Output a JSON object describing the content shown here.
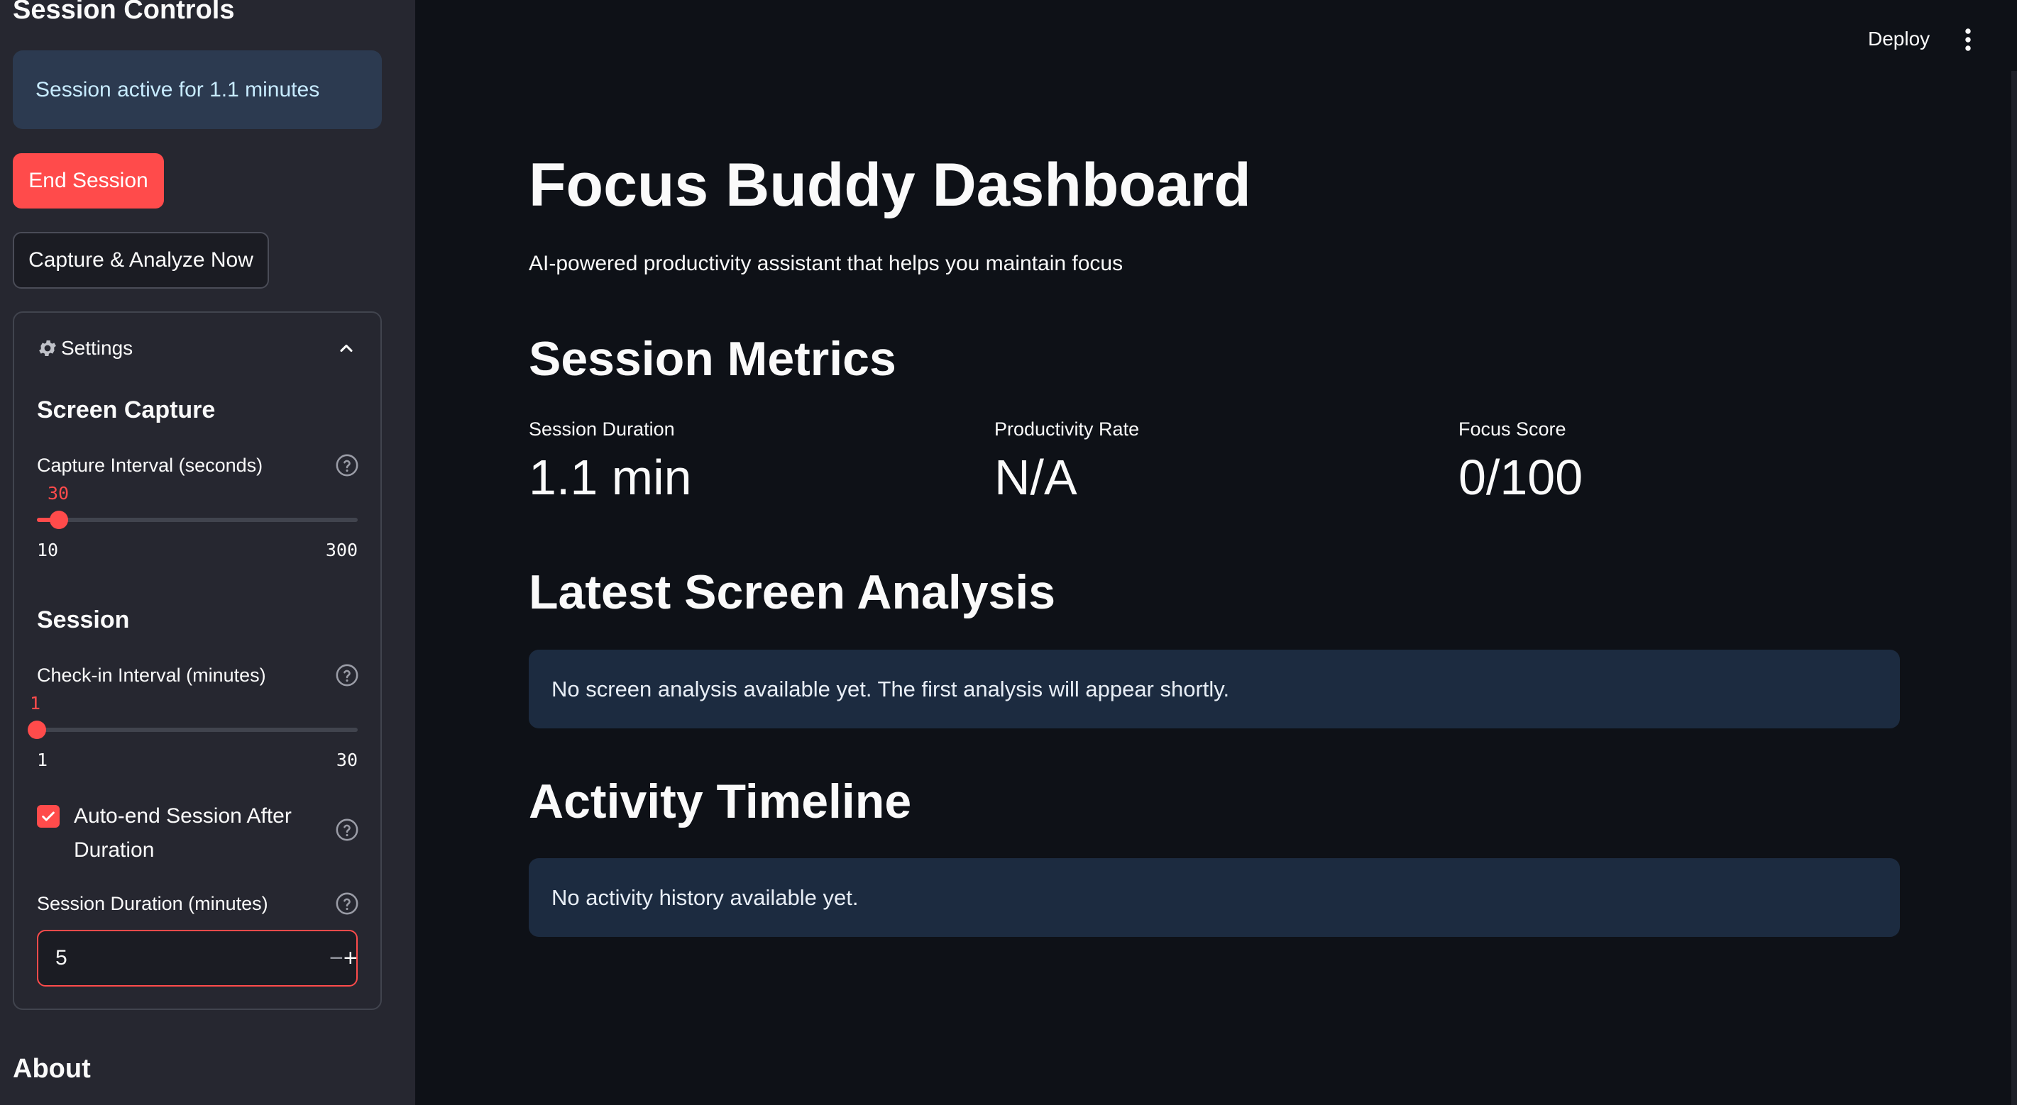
{
  "sidebar": {
    "title": "Session Controls",
    "session_status": "Session active for 1.1 minutes",
    "end_session_label": "End Session",
    "capture_label": "Capture & Analyze Now",
    "settings": {
      "label": "Settings",
      "screen_capture": {
        "heading": "Screen Capture",
        "capture_interval": {
          "label": "Capture Interval (seconds)",
          "value": "30",
          "min": "10",
          "max": "300"
        }
      },
      "session": {
        "heading": "Session",
        "checkin_interval": {
          "label": "Check-in Interval (minutes)",
          "value": "1",
          "min": "1",
          "max": "30"
        },
        "auto_end": {
          "label": "Auto-end Session After Duration",
          "checked": true
        },
        "session_duration": {
          "label": "Session Duration (minutes)",
          "value": "5",
          "minus": "−",
          "plus": "+"
        }
      }
    },
    "about_heading": "About"
  },
  "header": {
    "deploy_label": "Deploy"
  },
  "main": {
    "title": "Focus Buddy Dashboard",
    "subtitle": "AI-powered productivity assistant that helps you maintain focus",
    "metrics_heading": "Session Metrics",
    "metrics": [
      {
        "label": "Session Duration",
        "value": "1.1 min"
      },
      {
        "label": "Productivity Rate",
        "value": "N/A"
      },
      {
        "label": "Focus Score",
        "value": "0/100"
      }
    ],
    "analysis_heading": "Latest Screen Analysis",
    "analysis_message": "No screen analysis available yet. The first analysis will appear shortly.",
    "timeline_heading": "Activity Timeline",
    "timeline_message": "No activity history available yet."
  },
  "colors": {
    "accent": "#ff4b4b",
    "background": "#0e1117",
    "sidebar": "#262730",
    "info": "#1c2b40"
  }
}
